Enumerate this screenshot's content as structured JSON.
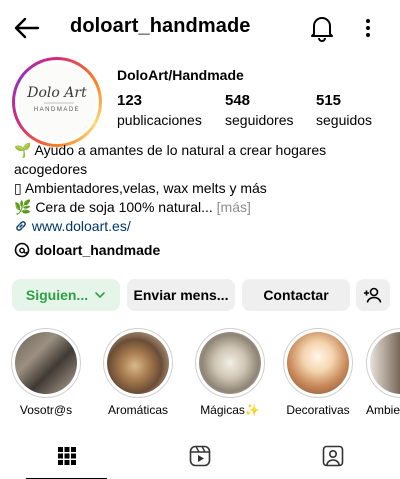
{
  "header": {
    "handle": "doloart_handmade"
  },
  "profile": {
    "logo_text": "Dolo Art",
    "logo_sub": "HANDMADE",
    "name": "DoloArt/Handmade",
    "stats": [
      {
        "value": "123",
        "label": "publicaciones"
      },
      {
        "value": "548",
        "label": "seguidores"
      },
      {
        "value": "515",
        "label": "seguidos"
      }
    ]
  },
  "bio": {
    "line1": "🌱 Ayudo a amantes de lo natural a crear hogares",
    "line2": "acogedores",
    "line3": "▯ Ambientadores,velas, wax melts y más",
    "line4": "🌿 Cera de soja 100% natural...",
    "more": "[más]",
    "link": "www.doloart.es/"
  },
  "threads": {
    "label": "doloart_handmade"
  },
  "buttons": {
    "follow": "Siguien...",
    "message": "Enviar mens...",
    "contact": "Contactar"
  },
  "highlights": [
    {
      "label": "Vosotr@s"
    },
    {
      "label": "Aromáticas"
    },
    {
      "label": "Mágicas✨"
    },
    {
      "label": "Decorativas"
    },
    {
      "label": "Ambie"
    }
  ],
  "colors": {
    "follow_text": "#2f9e44",
    "follow_bg": "#e6f5ea",
    "link": "#00376b",
    "button_bg": "#efefef"
  }
}
